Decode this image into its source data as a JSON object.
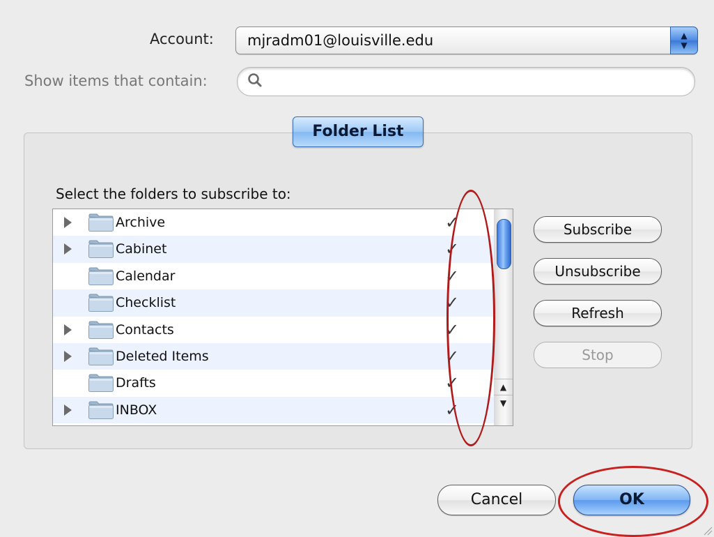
{
  "account": {
    "label": "Account:",
    "value": "mjradm01@louisville.edu"
  },
  "search": {
    "label": "Show items that contain:",
    "value": ""
  },
  "group_tab": {
    "label": "Folder List"
  },
  "list": {
    "instruction": "Select the folders to subscribe to:",
    "checkmark": "✓",
    "folders": [
      {
        "name": "Archive",
        "expandable": true,
        "subscribed": true
      },
      {
        "name": "Cabinet",
        "expandable": true,
        "subscribed": true
      },
      {
        "name": "Calendar",
        "expandable": false,
        "subscribed": true
      },
      {
        "name": "Checklist",
        "expandable": false,
        "subscribed": true
      },
      {
        "name": "Contacts",
        "expandable": true,
        "subscribed": true
      },
      {
        "name": "Deleted Items",
        "expandable": true,
        "subscribed": true
      },
      {
        "name": "Drafts",
        "expandable": false,
        "subscribed": true
      },
      {
        "name": "INBOX",
        "expandable": true,
        "subscribed": true
      }
    ]
  },
  "actions": {
    "subscribe": "Subscribe",
    "unsubscribe": "Unsubscribe",
    "refresh": "Refresh",
    "stop": "Stop"
  },
  "footer": {
    "cancel": "Cancel",
    "ok": "OK"
  },
  "colors": {
    "accent": "#5a9aee",
    "annotation": "#c81f1f",
    "row_alt": "#edf3fe"
  },
  "icons": {
    "search": "magnifier-icon",
    "folder": "folder-icon",
    "disclosure": "disclosure-triangle-icon",
    "check": "checkmark-icon"
  }
}
